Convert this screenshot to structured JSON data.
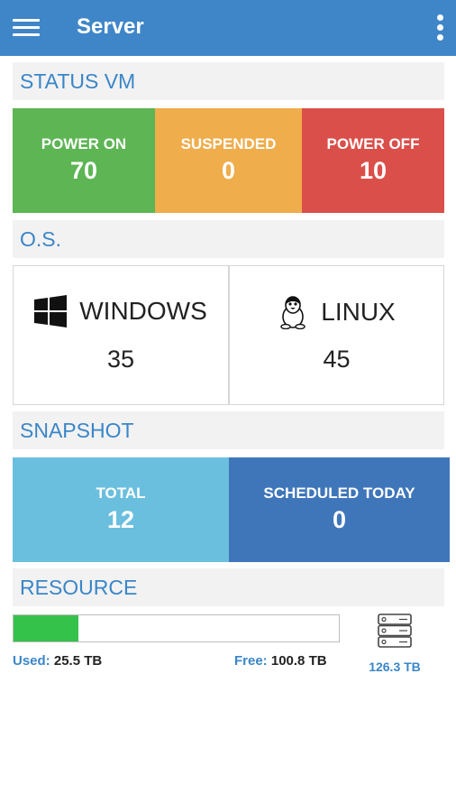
{
  "appbar": {
    "title": "Server",
    "menu_icon": "hamburger-menu-icon",
    "more_icon": "more-vert-icon"
  },
  "status_vm": {
    "heading": "STATUS VM",
    "tiles": [
      {
        "label": "POWER ON",
        "value": "70",
        "color": "#5db554"
      },
      {
        "label": "SUSPENDED",
        "value": "0",
        "color": "#efad4c"
      },
      {
        "label": "POWER OFF",
        "value": "10",
        "color": "#da4f4a"
      }
    ]
  },
  "os": {
    "heading": "O.S.",
    "cards": [
      {
        "name": "WINDOWS",
        "count": "35",
        "icon": "windows-icon"
      },
      {
        "name": "LINUX",
        "count": "45",
        "icon": "linux-tux-icon"
      }
    ]
  },
  "snapshot": {
    "heading": "SNAPSHOT",
    "tiles": [
      {
        "label": "TOTAL",
        "value": "12",
        "color": "#6bbfde"
      },
      {
        "label": "SCHEDULED TODAY",
        "value": "0",
        "color": "#3f76ba"
      }
    ]
  },
  "resource": {
    "heading": "RESOURCE",
    "used_label": "Used:",
    "used_value": "25.5 TB",
    "free_label": "Free:",
    "free_value": "100.8 TB",
    "total": "126.3 TB",
    "used_fraction": 0.2,
    "bar_color": "#34c24a",
    "icon": "storage-server-icon"
  }
}
